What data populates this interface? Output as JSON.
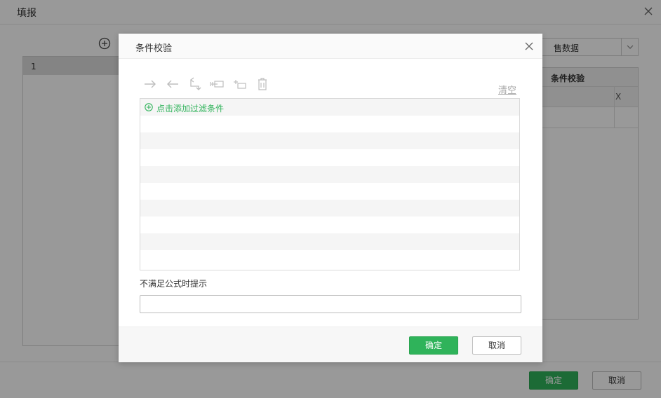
{
  "background": {
    "title": "填报",
    "left_panel": {
      "row_label": "1"
    },
    "select": {
      "value": "售数据"
    },
    "table": {
      "header": "条件校验",
      "cell": "X"
    },
    "footer": {
      "confirm_label": "确定",
      "cancel_label": "取消"
    }
  },
  "modal": {
    "title": "条件校验",
    "toolbar": {
      "icons": [
        "arrow-right-icon",
        "arrow-left-icon",
        "return-icon",
        "insert-condition-icon",
        "add-condition-icon",
        "trash-icon"
      ],
      "clear_label": "清空"
    },
    "condition_list": {
      "add_label": "点击添加过滤条件"
    },
    "prompt": {
      "label": "不满足公式时提示",
      "value": "",
      "placeholder": ""
    },
    "footer": {
      "confirm_label": "确定",
      "cancel_label": "取消"
    }
  },
  "colors": {
    "accent": "#2fb35a",
    "overlay": "rgba(0,0,0,0.40)",
    "row_stripe": "#f5f5f5"
  }
}
